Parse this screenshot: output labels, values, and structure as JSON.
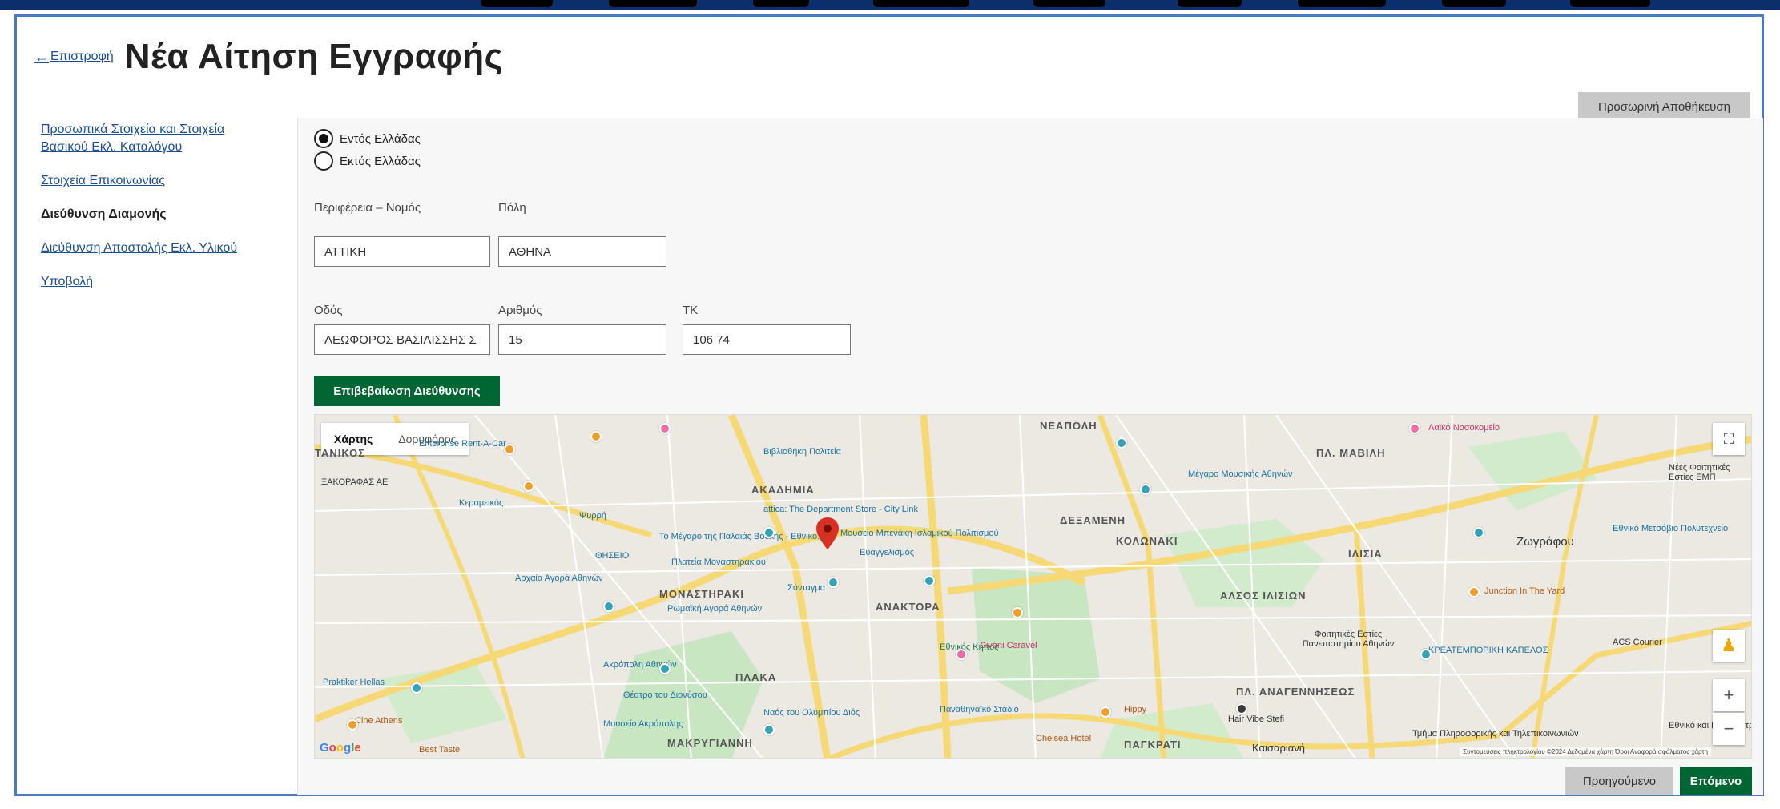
{
  "header": {
    "back_label": "Επιστροφή",
    "title": "Νέα Αίτηση Εγγραφής"
  },
  "toolbar": {
    "save_label": "Προσωρινή Αποθήκευση"
  },
  "sidebar": {
    "items": [
      {
        "label": "Προσωπικά Στοιχεία και Στοιχεία Βασικού Εκλ. Καταλόγου"
      },
      {
        "label": "Στοιχεία Επικοινωνίας"
      },
      {
        "label": "Διεύθυνση Διαμονής"
      },
      {
        "label": "Διεύθυνση Αποστολής Εκλ. Υλικού"
      },
      {
        "label": "Υποβολή"
      }
    ]
  },
  "form": {
    "location_options": [
      "Εντός Ελλάδας",
      "Εκτός Ελλάδας"
    ],
    "selected_location": "Εντός Ελλάδας",
    "region_label": "Περιφέρεια – Νομός",
    "region_value": "ΑΤΤΙΚΗ",
    "city_label": "Πόλη",
    "city_value": "ΑΘΗΝΑ",
    "street_label": "Οδός",
    "street_value": "ΛΕΩΦΟΡΟΣ ΒΑΣΙΛΙΣΣΗΣ Σ",
    "number_label": "Αριθμός",
    "number_value": "15",
    "zip_label": "ΤΚ",
    "zip_value": "106 74",
    "confirm_label": "Επιβεβαίωση Διεύθυνσης"
  },
  "map": {
    "tabs": [
      "Χάρτης",
      "Δορυφόρος"
    ],
    "active_tab": "Χάρτης",
    "labels": {
      "neapoli": "ΝΕΑΠΟΛΗ",
      "mavili": "ΠΛ. ΜΑΒΙΛΗ",
      "akadimia": "ΑΚΑΔΗΜΙΑ",
      "dexameni": "ΔΕΞΑΜΕΝΗ",
      "kolonaki": "ΚΟΛΩΝΑΚΙ",
      "ilisia": "ΙΛΙΣΙΑ",
      "monastiraki": "ΜΟΝΑΣΤΗΡΑΚΙ",
      "anaktora": "ΑΝΑΚΤΟΡΑ",
      "alsos": "ΑΛΣΟΣ ΙΛΙΣΙΩΝ",
      "plaka": "ΠΛΑΚΑ",
      "anagennisis": "ΠΛ. ΑΝΑΓΕΝΝΗΣΕΩΣ",
      "makrygianni": "ΜΑΚΡΥΓΙΑΝΝΗ",
      "pangrati": "ΠΑΓΚΡΑΤΙ",
      "zografou": "Ζωγράφου",
      "kaisariani": "Καισαριανή",
      "tanikos": "ΤΑΝΙΚΟΣ",
      "agora": "Αρχαία Αγορά Αθηνών",
      "roman_agora": "Ρωμαϊκή Αγορά Αθηνών",
      "acropolis": "Ακρόπολη Αθηνών",
      "acropolis_museum": "Μουσείο Ακρόπολης",
      "ethnikos_kipos": "Εθνικός Κήπος",
      "kallimarmaro": "Παναθηναϊκό Στάδιο",
      "theatro": "Θέατρο του Διονύσου",
      "olympian": "Ναός του Ολυμπίου Διός",
      "syntagma": "Σύνταγμα",
      "evangelismos": "Ευαγγελισμός",
      "platia_monastiraki": "Πλατεία Μοναστηρακίου",
      "megaro": "Το Μέγαρο της Παλαιάς Βουλής - Εθνικό...",
      "attica": "attica: The Department Store - City Link",
      "library": "Βιβλιοθήκη Πολιτεία",
      "megaro_mousikis": "Μέγαρο Μουσικής Αθηνών",
      "ntua": "Εθνικό Μετσόβιο Πολυτεχνείο",
      "benaki": "Μουσείο Μπενάκη Ισλαμικού Πολιτισμού",
      "divani": "Divani Caravel",
      "hair": "Hair Vibe Stefi",
      "hippy": "Hippy",
      "chelsea": "Chelsea Hotel",
      "praktiker": "Praktiker Hellas",
      "enterprise": "Enterprise Rent-A-Car",
      "best_taste": "Best Taste",
      "cine": "Cine Athens",
      "junction": "Junction In The Yard",
      "kreatem": "ΚΡΕΑΤΕΜΠΟΡΙΚΗ ΚΑΠΕΛΟΣ",
      "acs": "ACS Courier",
      "aiko": "Λαϊκό Νοσοκομείο",
      "xaikos": "ΞΑΚΟΡΑΦΑΣ ΑΕ",
      "foitit": "Φοιτητικές Εστίες Πανεπιστημίου Αθηνών",
      "nees_foit": "Νέες Φοιτητικές Εστίες ΕΜΠ",
      "thiseio": "ΘΗΣΕΙΟ",
      "psyrri": "Ψυρρή",
      "kerameikos": "Κεραμεικός",
      "ethniko_kai": "Εθνικό και Καποδιστριακό",
      "timima": "Τμήμα Πληροφορικής και Τηλεπικοινωνιών"
    },
    "footer": "Συντομεύσεις πληκτρολογίου  ©2024 Δεδομένα χάρτη  Όροι  Αναφορά σφάλματος χάρτη",
    "google": "Google"
  },
  "nav": {
    "prev_label": "Προηγούμενο",
    "next_label": "Επόμενο"
  },
  "colors": {
    "primary_green": "#006633",
    "link_blue": "#1a4f95",
    "frame_blue": "#4a7ac6",
    "marker_red": "#d93025"
  }
}
